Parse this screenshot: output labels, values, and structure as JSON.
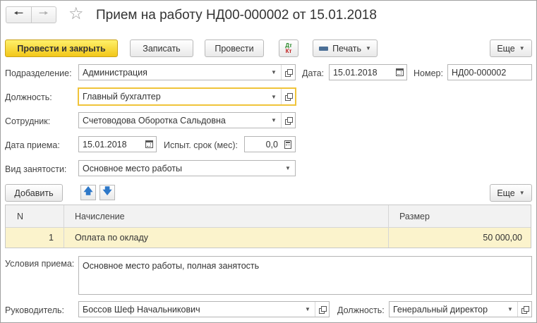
{
  "window": {
    "title": "Прием на работу НД00-000002 от 15.01.2018"
  },
  "icons": {
    "back": "back-arrow-icon",
    "forward": "forward-arrow-icon",
    "favorite": "star-icon"
  },
  "toolbar": {
    "post_and_close": "Провести и закрыть",
    "save": "Записать",
    "post": "Провести",
    "dtkt_top": "Дт",
    "dtkt_bottom": "Кт",
    "print": "Печать",
    "more": "Еще"
  },
  "form": {
    "division": {
      "label": "Подразделение:",
      "value": "Администрация"
    },
    "date": {
      "label": "Дата:",
      "value": "15.01.2018"
    },
    "number": {
      "label": "Номер:",
      "value": "НД00-000002"
    },
    "position": {
      "label": "Должность:",
      "value": "Главный бухгалтер"
    },
    "employee": {
      "label": "Сотрудник:",
      "value": "Счетоводова Оборотка Сальдовна"
    },
    "hire_date": {
      "label": "Дата приема:",
      "value": "15.01.2018"
    },
    "probation": {
      "label": "Испыт. срок (мес):",
      "value": "0,0"
    },
    "employment_type": {
      "label": "Вид занятости:",
      "value": "Основное место работы"
    }
  },
  "accruals": {
    "add_button": "Добавить",
    "more": "Еще",
    "columns": [
      "N",
      "Начисление",
      "Размер"
    ],
    "rows": [
      {
        "n": "1",
        "accrual": "Оплата по окладу",
        "amount": "50 000,00"
      }
    ]
  },
  "conditions": {
    "label": "Условия приема:",
    "value": "Основное место работы, полная занятость"
  },
  "manager": {
    "label": "Руководитель:",
    "value": "Боссов Шеф Начальникович",
    "position_label": "Должность:",
    "position_value": "Генеральный директор"
  },
  "colors": {
    "primary_button": "#f2c71a",
    "focus_border": "#f0c43a",
    "selected_row": "#fbf3cc",
    "arrow_blue": "#2e78c8"
  }
}
